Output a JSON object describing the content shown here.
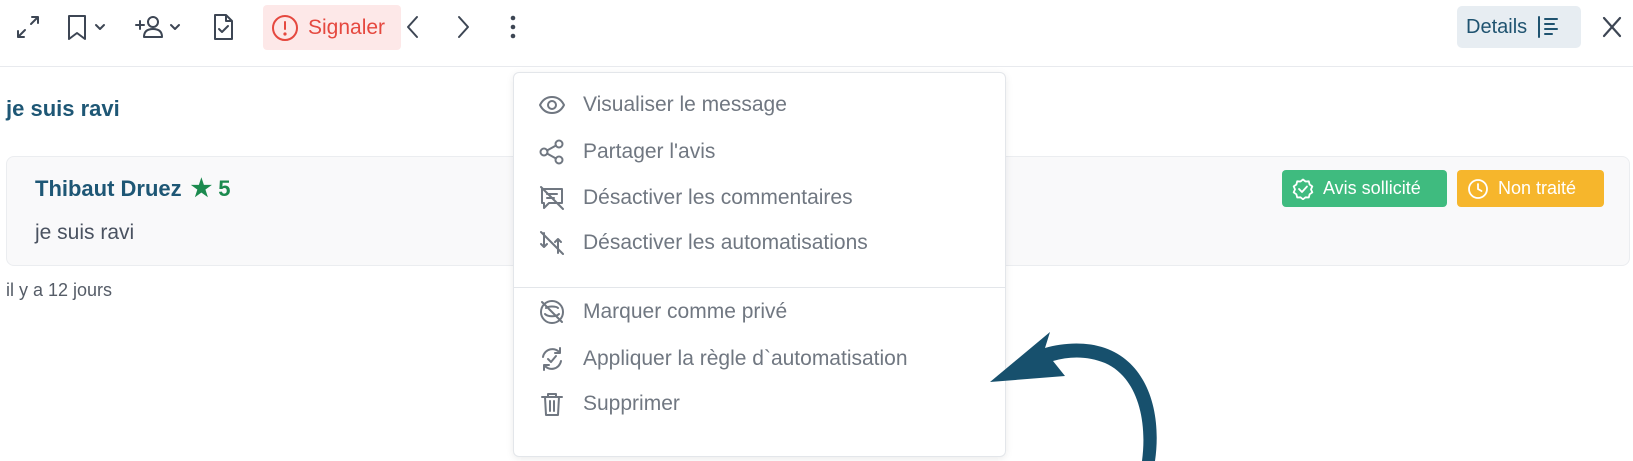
{
  "toolbar": {
    "signaler_label": "Signaler",
    "details_label": "Details",
    "icons": [
      "expand-icon",
      "bookmark-icon",
      "add-user-icon",
      "file-check-icon",
      "alert-icon",
      "chevron-left-icon",
      "chevron-right-icon",
      "more-vertical-icon",
      "details-icon",
      "close-icon"
    ]
  },
  "review": {
    "title": "je suis ravi",
    "author": "Thibaut Druez",
    "rating": "5",
    "text": "je suis ravi",
    "timestamp": "il y a 12 jours",
    "badges": [
      {
        "label": "Avis sollicité",
        "color": "#3fbb7f"
      },
      {
        "label": "Non traité",
        "color": "#f6b62c"
      }
    ]
  },
  "menu": {
    "items": [
      {
        "label": "Visualiser le message",
        "icon": "eye-icon"
      },
      {
        "label": "Partager l'avis",
        "icon": "share-icon"
      },
      {
        "label": "Désactiver les commentaires",
        "icon": "comment-off-icon"
      },
      {
        "label": "Désactiver les automatisations",
        "icon": "automation-off-icon"
      },
      {
        "label": "Marquer comme privé",
        "icon": "private-icon"
      },
      {
        "label": "Appliquer la règle d`automatisation",
        "icon": "automation-rule-icon"
      },
      {
        "label": "Supprimer",
        "icon": "trash-icon"
      }
    ]
  },
  "colors": {
    "primary": "#1e5775",
    "danger": "#e5483f",
    "success": "#3fbb7f",
    "warning": "#f6b62c",
    "arrow": "#17506d"
  }
}
